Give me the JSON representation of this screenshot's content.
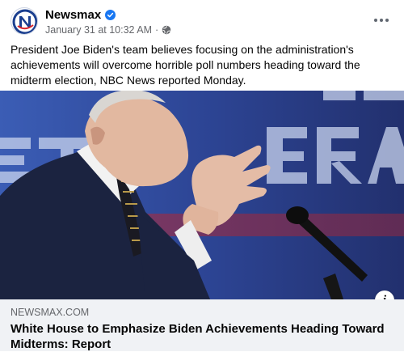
{
  "post": {
    "author": "Newsmax",
    "verified_icon": "verified-badge-icon",
    "timestamp": "January 31 at 10:32 AM",
    "separator": "·",
    "audience_icon": "globe-icon",
    "more_icon": "more-options-icon",
    "text": "President Joe Biden's team believes focusing on the administration's achievements will overcome horrible poll numbers heading toward the midterm election, NBC News reported Monday."
  },
  "link_preview": {
    "domain": "NEWSMAX.COM",
    "title": "White House to Emphasize Biden Achievements Heading Toward Midterms: Report",
    "info_icon": "info-icon",
    "info_glyph": "i",
    "image_description_icon": "news-photo"
  },
  "colors": {
    "verified": "#1877f2",
    "secondary_text": "#65676b",
    "footer_bg": "#f0f2f5",
    "avatar_brand": "#1b3f8f",
    "avatar_accent": "#d8232a"
  }
}
